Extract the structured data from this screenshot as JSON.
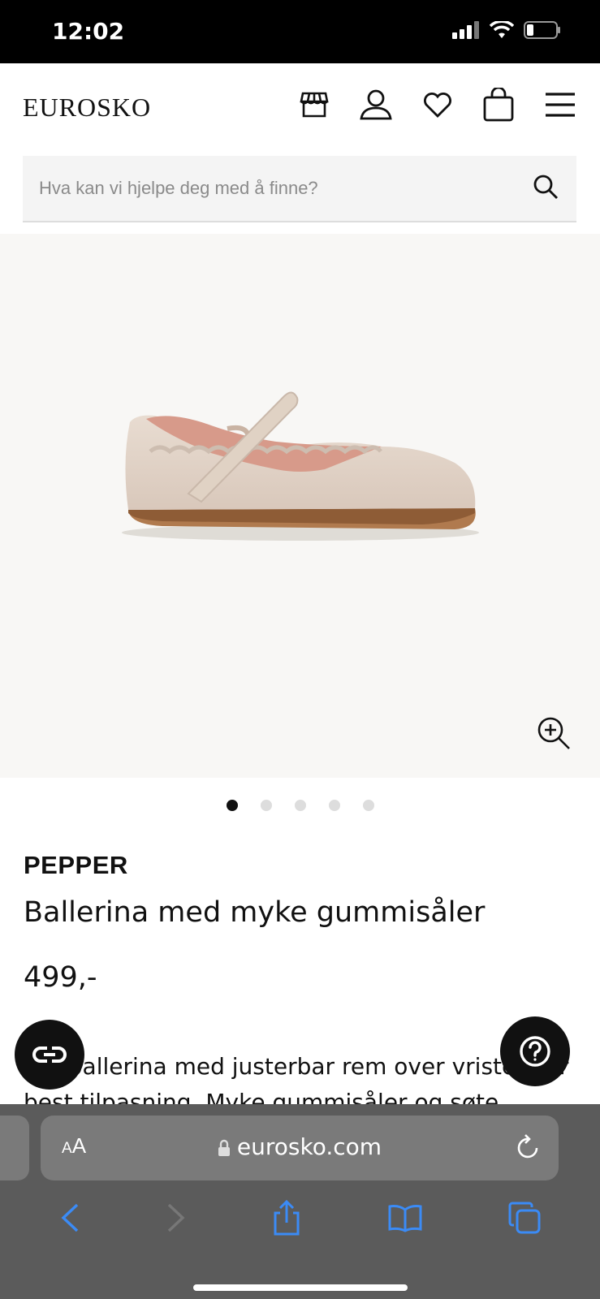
{
  "status_bar": {
    "time": "12:02"
  },
  "header": {
    "logo": "EUROSKO"
  },
  "search": {
    "placeholder": "Hva kan vi hjelpe deg med å finne?"
  },
  "gallery": {
    "dot_count": 5,
    "active_index": 0
  },
  "product": {
    "brand": "PEPPER",
    "name": "Ballerina med myke gummisåler",
    "price": "499,-",
    "description": "Søt ballerina med justerbar rem over vristen for best tilpasning. Myke gummisåler og søte"
  },
  "browser": {
    "aa_small": "A",
    "aa_large": "A",
    "url": "eurosko.com"
  },
  "colors": {
    "accent_link": "#3b8bf6",
    "hero_bg": "#f8f7f5",
    "safari_bg": "#5b5b5b"
  }
}
